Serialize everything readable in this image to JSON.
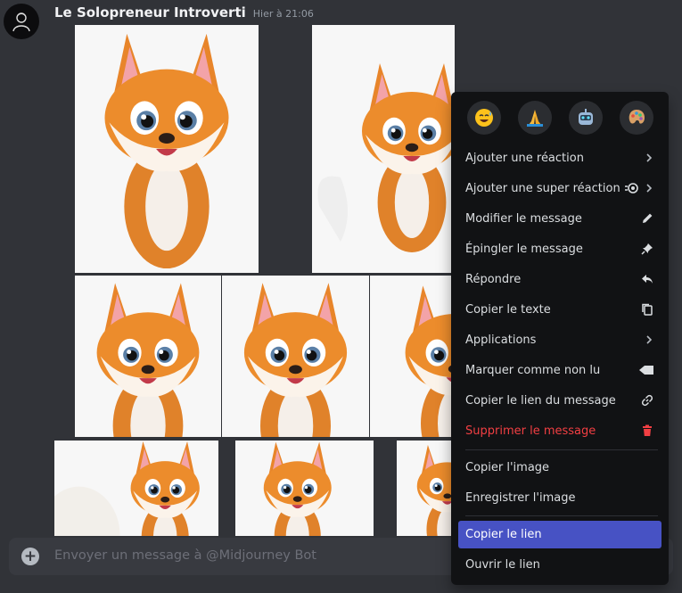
{
  "message": {
    "author": "Le Solopreneur Introverti",
    "timestamp": "Hier à 21:06"
  },
  "composer": {
    "placeholder": "Envoyer un message à @Midjourney Bot"
  },
  "context_menu": {
    "quick_reactions": [
      "sweat-smile-emoji",
      "folded-hands-emoji",
      "robot-emoji",
      "artist-palette-emoji"
    ],
    "items": [
      {
        "label": "Ajouter une réaction",
        "icon": "chevron-right-icon"
      },
      {
        "label": "Ajouter une super réaction",
        "icon": "super-reaction-icon"
      },
      {
        "label": "Modifier le message",
        "icon": "pencil-icon"
      },
      {
        "label": "Épingler le message",
        "icon": "pin-icon"
      },
      {
        "label": "Répondre",
        "icon": "reply-icon"
      },
      {
        "label": "Copier le texte",
        "icon": "copy-icon"
      },
      {
        "label": "Applications",
        "icon": "chevron-right-icon"
      },
      {
        "label": "Marquer comme non lu",
        "icon": "unread-flag-icon"
      },
      {
        "label": "Copier le lien du message",
        "icon": "link-icon"
      },
      {
        "label": "Supprimer le message",
        "icon": "trash-icon"
      },
      {
        "label": "Copier l'image"
      },
      {
        "label": "Enregistrer l'image"
      },
      {
        "label": "Copier le lien"
      },
      {
        "label": "Ouvrir le lien"
      }
    ],
    "highlighted_item": "Copier le lien",
    "colors": {
      "danger": "#f23f43",
      "highlight": "#4752c4"
    }
  }
}
